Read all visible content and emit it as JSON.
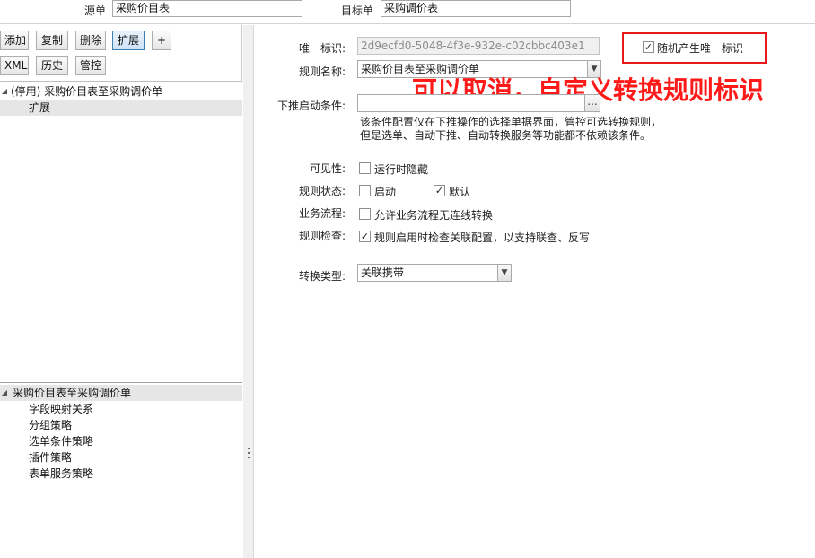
{
  "top": {
    "source_label": "源单",
    "source_value": "采购价目表",
    "target_label": "目标单",
    "target_value": "采购调价表"
  },
  "toolbar": {
    "add": "添加",
    "copy": "复制",
    "delete": "删除",
    "extend": "扩展",
    "plus": "+",
    "xml": "XML",
    "history": "历史",
    "control": "管控"
  },
  "tree_top": {
    "root": "(停用) 采购价目表至采购调价单",
    "child": "扩展"
  },
  "tree_bottom": {
    "root": "采购价目表至采购调价单",
    "items": [
      "字段映射关系",
      "分组策略",
      "选单条件策略",
      "插件策略",
      "表单服务策略"
    ]
  },
  "form": {
    "uid_label": "唯一标识:",
    "uid_value": "2d9ecfd0-5048-4f3e-932e-c02cbbc403e1",
    "random_uid_label": "随机产生唯一标识",
    "random_uid_checked": true,
    "rule_name_label": "规则名称:",
    "rule_name_value": "采购价目表至采购调价单",
    "push_condition_label": "下推启动条件:",
    "push_condition_value": "",
    "ellipsis": "...",
    "note_line1": "该条件配置仅在下推操作的选择单据界面，管控可选转换规则，",
    "note_line2": "但是选单、自动下推、自动转换服务等功能都不依赖该条件。",
    "visibility_label": "可见性:",
    "hide_at_runtime": "运行时隐藏",
    "rule_status_label": "规则状态:",
    "enabled": "启动",
    "default": "默认",
    "biz_flow_label": "业务流程:",
    "allow_offline": "允许业务流程无连线转换",
    "rule_check_label": "规则检查:",
    "rule_check_text": "规则启用时检查关联配置，以支持联查、反写",
    "convert_type_label": "转换类型:",
    "convert_type_value": "关联携带"
  },
  "checkbox_states": {
    "hide_at_runtime": false,
    "enabled": false,
    "default": true,
    "allow_offline": false,
    "rule_check": true
  },
  "annotation": {
    "text": "可以取消，自定义转换规则标识",
    "color": "#ff1a1a"
  },
  "icons": {
    "expand": "triangle-down-icon",
    "dropdown": "chevron-down-icon",
    "check": "checkmark-icon"
  }
}
